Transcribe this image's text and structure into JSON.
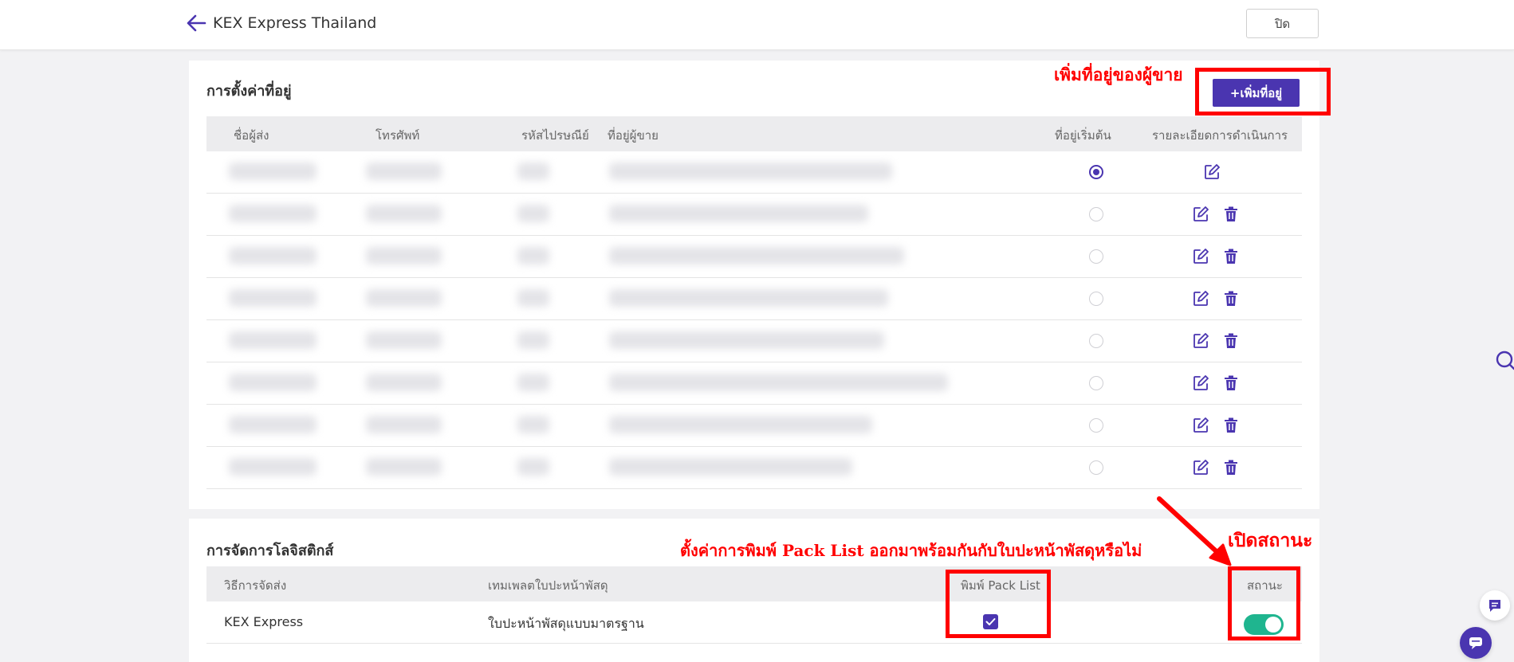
{
  "header": {
    "title": "KEX Express Thailand",
    "close_label": "ปิด"
  },
  "address_section": {
    "title": "การตั้งค่าที่อยู่",
    "add_button_label": "+เพิ่มที่อยู่",
    "columns": [
      "ชื่อผู้ส่ง",
      "โทรศัพท์",
      "รหัสไปรษณีย์",
      "ที่อยู่ผู้ขาย",
      "ที่อยู่เริ่มต้น",
      "รายละเอียดการดำเนินการ"
    ],
    "rows": [
      {
        "default": true,
        "deletable": false
      },
      {
        "default": false,
        "deletable": true
      },
      {
        "default": false,
        "deletable": true
      },
      {
        "default": false,
        "deletable": true
      },
      {
        "default": false,
        "deletable": true
      },
      {
        "default": false,
        "deletable": true
      },
      {
        "default": false,
        "deletable": true
      },
      {
        "default": false,
        "deletable": true
      }
    ]
  },
  "logistics_section": {
    "title": "การจัดการโลจิสติกส์",
    "columns": [
      "วิธีการจัดส่ง",
      "เทมเพลตใบปะหน้าพัสดุ",
      "พิมพ์ Pack List",
      "สถานะ"
    ],
    "row": {
      "method": "KEX Express",
      "template": "ใบปะหน้าพัสดุแบบมาตรฐาน",
      "print_pack_list": true,
      "status_on": true
    }
  },
  "annotations": {
    "add_address": "เพิ่มที่อยู่ของผู้ขาย",
    "pack_list": "ตั้งค่าการพิมพ์ Pack List ออกมาพร้อมกันกับใบปะหน้าพัสดุหรือไม่",
    "status": "เปิดสถานะ"
  },
  "colors": {
    "accent": "#4a35b0",
    "toggle_on": "#1fb58f",
    "annotation": "#ff0000"
  },
  "icons": [
    "arrow-left-icon",
    "edit-icon",
    "trash-icon",
    "check-icon",
    "search-icon",
    "chat-icon"
  ]
}
